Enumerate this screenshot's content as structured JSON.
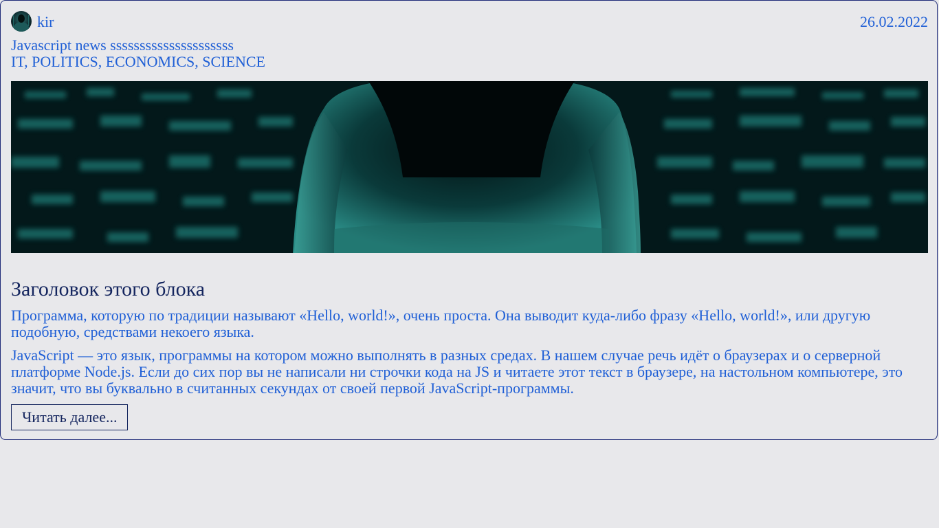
{
  "author": {
    "name": "kir",
    "avatar_icon": "hacker-avatar-icon"
  },
  "date": "26.02.2022",
  "post": {
    "subtitle": "Javascript news sssssssssssssssssssss",
    "tags": "IT, POLITICS, ECONOMICS, SCIENCE",
    "banner_icon": "hooded-hacker-image",
    "title": "Заголовок этого блока",
    "paragraphs": [
      "Программа, которую по традиции называют «Hello, world!», очень проста. Она выводит куда-либо фразу «Hello, world!», или другую подобную, средствами некоего языка.",
      "JavaScript — это язык, программы на котором можно выполнять в разных средах. В нашем случае речь идёт о браузерах и о серверной платформе Node.js. Если до сих пор вы не написали ни строчки кода на JS и читаете этот текст в браузере, на настольном компьютере, это значит, что вы буквально в считанных секундах от своей первой JavaScript-программы."
    ],
    "read_more_label": "Читать далее..."
  },
  "colors": {
    "accent_text": "#1f5fd6",
    "heading_text": "#14255e",
    "border": "#1e2a78",
    "background": "#e8e8eb"
  }
}
